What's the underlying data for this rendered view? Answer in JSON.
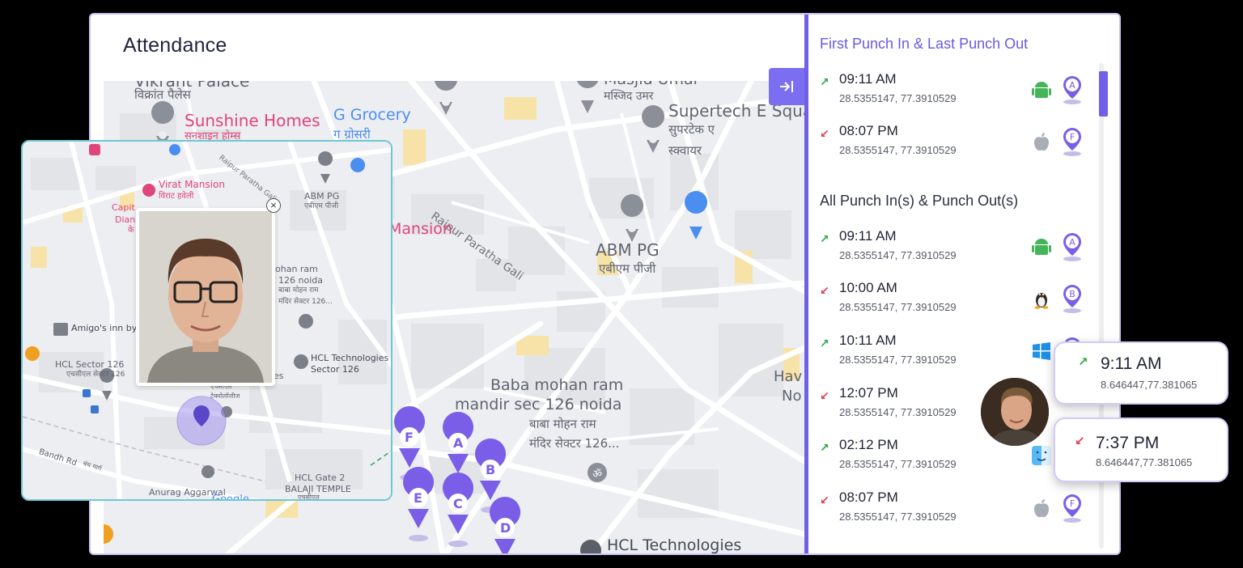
{
  "app": {
    "title": "Attendance"
  },
  "colors": {
    "accent": "#7060e8",
    "in_arrow": "#2ea84a",
    "out_arrow": "#e03a4c",
    "pin": "#7b5ee8"
  },
  "map": {
    "labels": [
      "Vikrant Palace",
      "विक्रांत पैलेस",
      "Sunshine Homes",
      "सनशाइन होम्स",
      "G Grocery",
      "ग ग्रोसरी",
      "Masjid Umar",
      "मस्जिद उमर",
      "Supertech E Square",
      "सुपरटेक ए",
      "स्क्वायर",
      "Raipur Paratha Gali",
      "ABM PG",
      "एबीएम पीजी",
      "Mansion",
      "Baba mohan ram",
      "mandir sec 126 noida",
      "बाबा मोहन राम",
      "मंदिर सेक्टर 126...",
      "HCL Technologies",
      "Hav",
      "No"
    ],
    "pins": [
      "F",
      "A",
      "B",
      "E",
      "C",
      "D"
    ]
  },
  "collapse_button": {
    "icon": "collapse-right-icon"
  },
  "inset_map": {
    "labels": [
      "Virat Mansion",
      "विराट हवेली",
      "Capit",
      "Dian",
      "के",
      "Raipur Paratha Gali",
      "ABM PG",
      "एबीएम पीजी",
      "ohan ram",
      "126 noida",
      "बाबा मोहन राम",
      "मंदिर सेक्टर 126...",
      "Amigo's inn by",
      "HCL Sector 126",
      "एचसीएल सेक्टर 126",
      "HCL Technologies",
      "Sector 126",
      "gies",
      "एचसीएल",
      "टेक्नोलॉजीज",
      "Bandh Rd",
      "बंध मार्ग",
      "HCL Gate 2",
      "BALAJI TEMPLE",
      "Anurag Aggarwal",
      "एचसीएल",
      "Google"
    ],
    "close_label": "×"
  },
  "side_panel": {
    "first_last_title": "First Punch In & Last Punch Out",
    "first_last": [
      {
        "dir": "in",
        "arrow": "↗",
        "time": "09:11 AM",
        "coords": "28.5355147, 77.3910529",
        "os": "android-icon",
        "pin": "A"
      },
      {
        "dir": "out",
        "arrow": "↙",
        "time": "08:07 PM",
        "coords": "28.5355147, 77.3910529",
        "os": "apple-icon",
        "pin": "F"
      }
    ],
    "all_title": "All Punch In(s) & Punch Out(s)",
    "all": [
      {
        "dir": "in",
        "arrow": "↗",
        "time": "09:11 AM",
        "coords": "28.5355147, 77.3910529",
        "os": "android-icon",
        "pin": "A"
      },
      {
        "dir": "out",
        "arrow": "↙",
        "time": "10:00 AM",
        "coords": "28.5355147, 77.3910529",
        "os": "linux-icon",
        "pin": "B"
      },
      {
        "dir": "in",
        "arrow": "↗",
        "time": "10:11 AM",
        "coords": "28.5355147, 77.3910529",
        "os": "windows-icon",
        "pin": "C"
      },
      {
        "dir": "out",
        "arrow": "↙",
        "time": "12:07 PM",
        "coords": "28.5355147, 77.3910529",
        "os": "none",
        "pin": "D"
      },
      {
        "dir": "in",
        "arrow": "↗",
        "time": "02:12 PM",
        "coords": "28.5355147, 77.3910529",
        "os": "finder-icon",
        "pin": "E"
      },
      {
        "dir": "out",
        "arrow": "↙",
        "time": "08:07 PM",
        "coords": "28.5355147, 77.3910529",
        "os": "apple-icon",
        "pin": "F"
      }
    ]
  },
  "floating_cards": [
    {
      "arrow": "↗",
      "time": "9:11 AM",
      "coords": "8.646447,77.381065"
    },
    {
      "arrow": "↙",
      "time": "7:37 PM",
      "coords": "8.646447,77.381065"
    }
  ]
}
